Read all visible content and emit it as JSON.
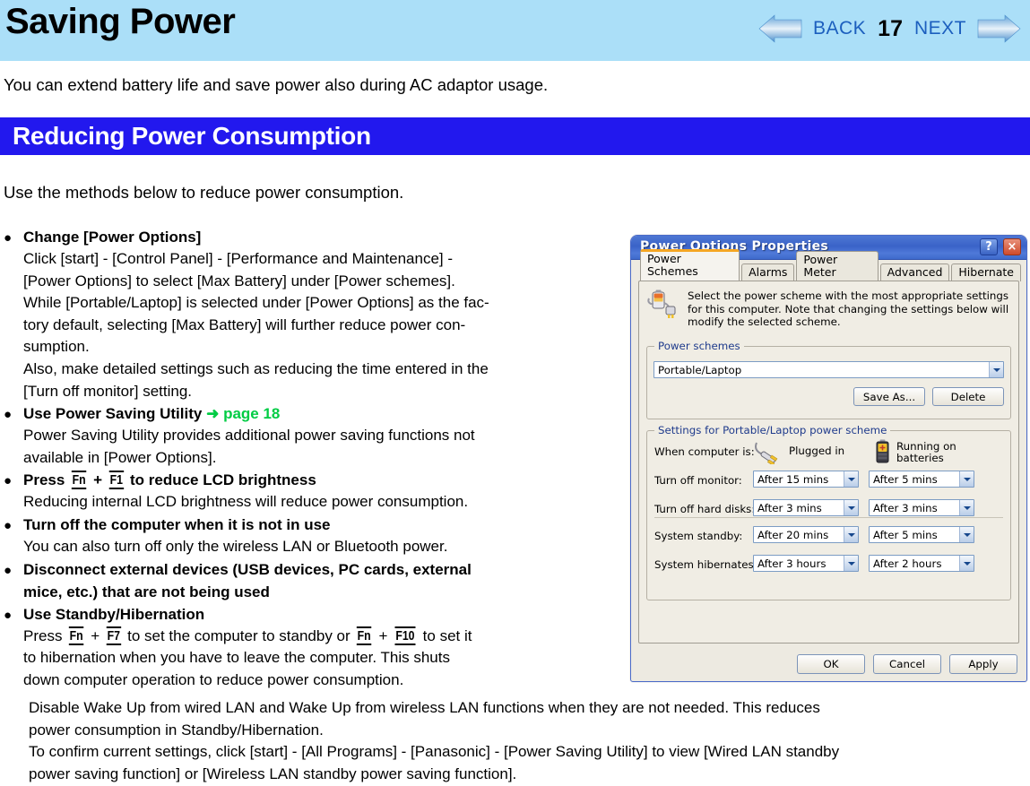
{
  "header": {
    "title": "Saving Power",
    "nav": {
      "back_label": "BACK",
      "page_number": "17",
      "next_label": "NEXT",
      "back_icon": "left-arrow-icon",
      "next_icon": "right-arrow-icon"
    },
    "band_color": "#ABDFF8",
    "link_color": "#1C5FBE"
  },
  "intro": "You can extend battery life and save power also during AC adaptor usage.",
  "section": {
    "title": "Reducing Power Consumption",
    "bar_color": "#2218EE"
  },
  "lead": "Use the methods below to reduce power consumption.",
  "bullets": [
    {
      "heading": "Change [Power Options]",
      "lines": [
        "Click [start] - [Control Panel] - [Performance and Maintenance] -",
        "[Power Options] to select [Max Battery] under [Power schemes].",
        "While [Portable/Laptop] is selected under [Power Options] as the fac-",
        "tory default, selecting [Max Battery] will further reduce power con-",
        "sumption.",
        "Also, make detailed settings such as reducing the time entered in the",
        "[Turn off monitor] setting."
      ]
    },
    {
      "heading": "Use Power Saving Utility",
      "link_arrow": "➜",
      "link_text": "page 18",
      "link_color": "#00CC44",
      "lines": [
        "Power Saving Utility provides additional power saving functions not",
        "available in [Power Options]."
      ]
    },
    {
      "heading_pre": "Press ",
      "key1": "Fn",
      "heading_mid": " + ",
      "key2": "F1",
      "heading_post": " to reduce LCD brightness",
      "lines": [
        "Reducing internal LCD brightness will reduce power consumption."
      ]
    },
    {
      "heading": "Turn off the computer when it is not in use",
      "lines": [
        "You can also turn off only the wireless LAN or Bluetooth power."
      ]
    },
    {
      "heading": "Disconnect external devices (USB devices, PC cards, external",
      "heading2": "mice, etc.) that are not being used",
      "lines": []
    },
    {
      "heading": "Use Standby/Hibernation",
      "press_pre": "Press ",
      "key1": "Fn",
      "press_mid1": " + ",
      "key2": "F7",
      "press_mid2": " to set the computer to standby or ",
      "key3": "Fn",
      "press_mid3": " + ",
      "key4": "F10",
      "press_post": " to set it",
      "lines": [
        "to hibernation when you have to leave the computer. This shuts",
        "down computer operation to reduce power consumption."
      ]
    }
  ],
  "tail_lines": [
    "Disable Wake Up from wired LAN and Wake Up from wireless LAN functions when they are not needed. This reduces",
    "power consumption in Standby/Hibernation.",
    "To confirm current settings, click [start] - [All Programs] - [Panasonic] - [Power Saving Utility] to view [Wired LAN standby",
    "power saving function] or [Wireless LAN standby power saving function]."
  ],
  "dialog": {
    "title": "Power Options Properties",
    "help_button": "?",
    "close_button": "×",
    "tabs": [
      {
        "label": "Power Schemes",
        "active": true
      },
      {
        "label": "Alarms",
        "active": false
      },
      {
        "label": "Power Meter",
        "active": false
      },
      {
        "label": "Advanced",
        "active": false
      },
      {
        "label": "Hibernate",
        "active": false
      }
    ],
    "description": "Select the power scheme with the most appropriate settings for this computer. Note that changing the settings below will modify the selected scheme.",
    "power_schemes": {
      "group_label": "Power schemes",
      "selected": "Portable/Laptop",
      "save_as_label": "Save As...",
      "delete_label": "Delete"
    },
    "settings": {
      "group_label": "Settings for Portable/Laptop power scheme",
      "when_computer_label": "When computer is:",
      "col_plugged": "Plugged in",
      "col_batteries_line1": "Running on",
      "col_batteries_line2": "batteries",
      "rows": [
        {
          "label": "Turn off monitor:",
          "plugged": "After 15 mins",
          "battery": "After 5 mins"
        },
        {
          "label": "Turn off hard disks:",
          "plugged": "After 3 mins",
          "battery": "After 3 mins"
        },
        {
          "label": "System standby:",
          "plugged": "After 20 mins",
          "battery": "After 5 mins"
        },
        {
          "label": "System hibernates:",
          "plugged": "After 3 hours",
          "battery": "After 2 hours"
        }
      ]
    },
    "buttons": {
      "ok": "OK",
      "cancel": "Cancel",
      "apply": "Apply"
    },
    "titlebar_color": "#3A63C8"
  }
}
